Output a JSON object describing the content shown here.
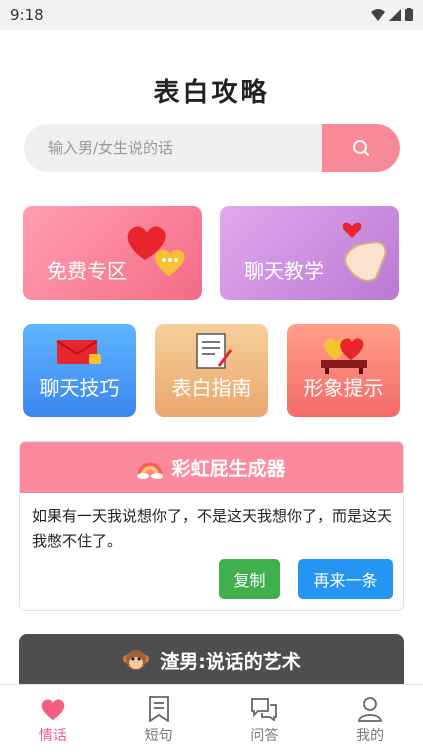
{
  "status": {
    "time": "9:18"
  },
  "title": "表白攻略",
  "search": {
    "placeholder": "输入男/女生说的话"
  },
  "cards": {
    "free": "免费专区",
    "teach": "聊天教学",
    "skill": "聊天技巧",
    "guide": "表白指南",
    "image": "形象提示"
  },
  "rainbow": {
    "title": "彩虹屁生成器",
    "text": "如果有一天我说想你了，不是这天我想你了，而是这天我憋不住了。",
    "copy": "复制",
    "next": "再来一条"
  },
  "zanan": {
    "title": "渣男:说话的艺术"
  },
  "tabs": [
    "情话",
    "短句",
    "问答",
    "我的"
  ],
  "colors": {
    "accent": "#f25d80",
    "search_button": "#f78a96",
    "copy": "#3fb04c",
    "next": "#2595f3"
  }
}
